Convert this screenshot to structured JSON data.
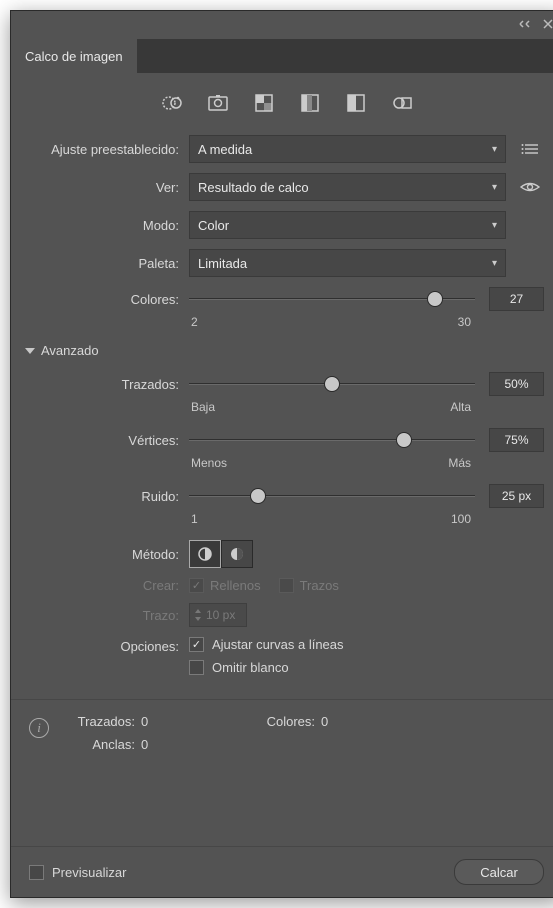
{
  "title": "Calco de imagen",
  "toolbar": {
    "icons": [
      "auto",
      "photo",
      "low-colors",
      "grayscale",
      "bw",
      "outline"
    ]
  },
  "preset": {
    "label": "Ajuste preestablecido:",
    "value": "A medida"
  },
  "view": {
    "label": "Ver:",
    "value": "Resultado de calco"
  },
  "mode": {
    "label": "Modo:",
    "value": "Color"
  },
  "palette": {
    "label": "Paleta:",
    "value": "Limitada"
  },
  "colors": {
    "label": "Colores:",
    "value": "27",
    "min": "2",
    "max": "30",
    "pos": 86
  },
  "advanced": {
    "label": "Avanzado"
  },
  "paths": {
    "label": "Trazados:",
    "value": "50%",
    "min": "Baja",
    "max": "Alta",
    "pos": 50
  },
  "corners": {
    "label": "Vértices:",
    "value": "75%",
    "min": "Menos",
    "max": "Más",
    "pos": 75
  },
  "noise": {
    "label": "Ruido:",
    "value": "25 px",
    "min": "1",
    "max": "100",
    "pos": 24
  },
  "method": {
    "label": "Método:"
  },
  "create": {
    "label": "Crear:",
    "fills": "Rellenos",
    "strokes": "Trazos"
  },
  "stroke": {
    "label": "Trazo:",
    "value": "10 px"
  },
  "options": {
    "label": "Opciones:",
    "snap": "Ajustar curvas a líneas",
    "ignore_white": "Omitir blanco"
  },
  "stats": {
    "paths_label": "Trazados:",
    "paths_val": "0",
    "colors_label": "Colores:",
    "colors_val": "0",
    "anchors_label": "Anclas:",
    "anchors_val": "0"
  },
  "footer": {
    "preview": "Previsualizar",
    "trace": "Calcar"
  }
}
